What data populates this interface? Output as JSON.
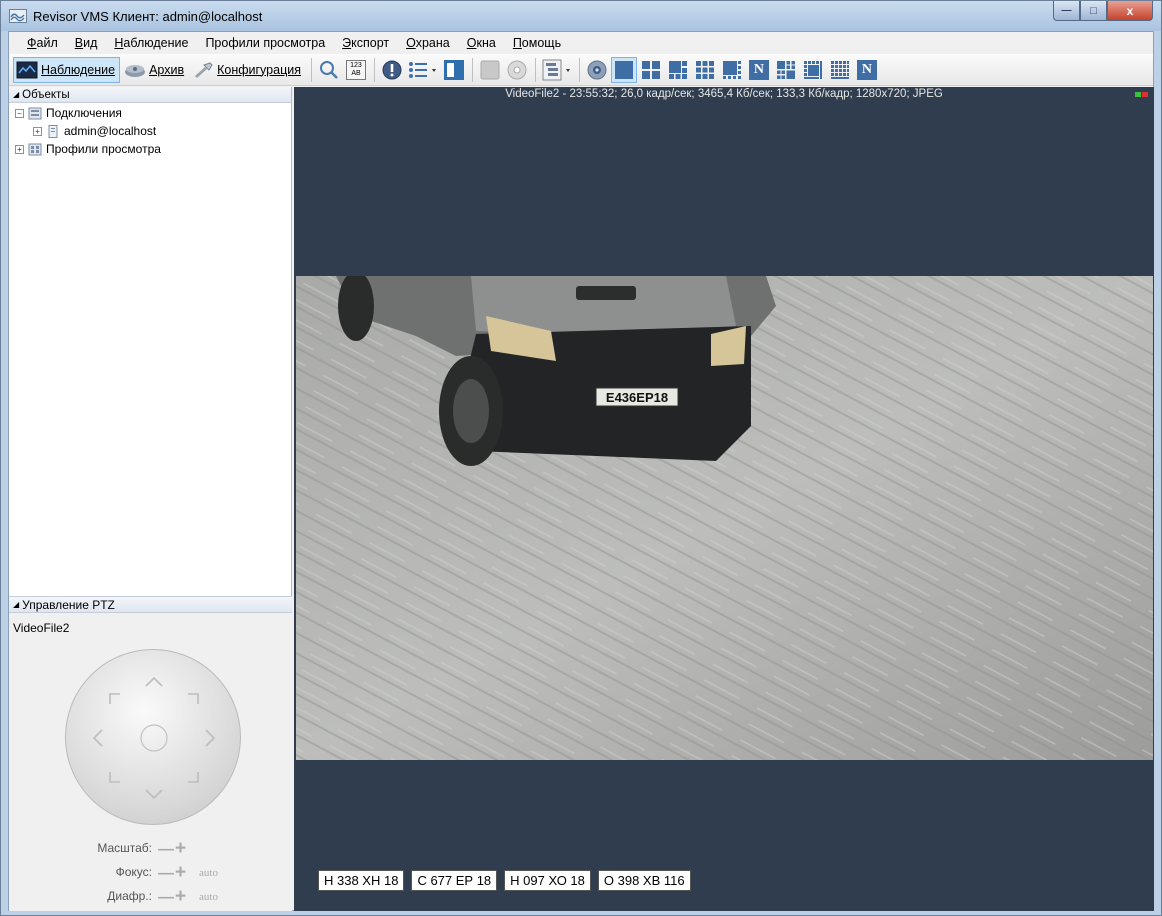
{
  "window": {
    "title": "Revisor VMS Клиент: admin@localhost",
    "controls": {
      "minimize": "—",
      "maximize": "□",
      "close": "x"
    }
  },
  "menu": [
    {
      "label": "Файл",
      "accel": "Ф",
      "rest": "айл"
    },
    {
      "label": "Вид",
      "accel": "В",
      "rest": "ид"
    },
    {
      "label": "Наблюдение",
      "accel": "Н",
      "rest": "аблюдение"
    },
    {
      "label": "Профили просмотра",
      "accel": "",
      "rest": "Профили просмотра"
    },
    {
      "label": "Экспорт",
      "accel": "Э",
      "rest": "кспорт"
    },
    {
      "label": "Охрана",
      "accel": "О",
      "rest": "храна"
    },
    {
      "label": "Окна",
      "accel": "О",
      "rest": "кна"
    },
    {
      "label": "Помощь",
      "accel": "П",
      "rest": "омощь"
    }
  ],
  "toolbar": {
    "modes": [
      {
        "label": "Наблюдение",
        "icon": "monitor-icon",
        "active": true
      },
      {
        "label": "Архив",
        "icon": "archive-icon",
        "active": false
      },
      {
        "label": "Конфигурация",
        "icon": "wrench-icon",
        "active": false
      }
    ],
    "counter_icon_text": "123 AB",
    "n_label": "N"
  },
  "objects_panel": {
    "title": "Объекты",
    "tree": [
      {
        "label": "Подключения",
        "expander": "−",
        "icon": "connections-icon"
      },
      {
        "label": "admin@localhost",
        "expander": "+",
        "icon": "server-icon"
      },
      {
        "label": "Профили просмотра",
        "expander": "+",
        "icon": "profiles-icon"
      }
    ]
  },
  "ptz_panel": {
    "title": "Управление PTZ",
    "camera": "VideoFile2",
    "rows": [
      {
        "label": "Масштаб:",
        "auto": ""
      },
      {
        "label": "Фокус:",
        "auto": "auto"
      },
      {
        "label": "Диафр.:",
        "auto": "auto"
      }
    ]
  },
  "video": {
    "header": "VideoFile2 - 23:55:32; 26,0 кадр/сек; 3465,4 Кб/сек; 133,3 Кб/кадр; 1280x720; JPEG",
    "frame_plate": "Е436ЕР18",
    "recognized_plates": [
      "Н 338 ХН 18",
      "С 677 ЕР 18",
      "Н 097 ХО 18",
      "О 398 ХВ 116"
    ],
    "status_colors": {
      "ok": "#3fbf3f",
      "alert": "#e03030"
    }
  }
}
